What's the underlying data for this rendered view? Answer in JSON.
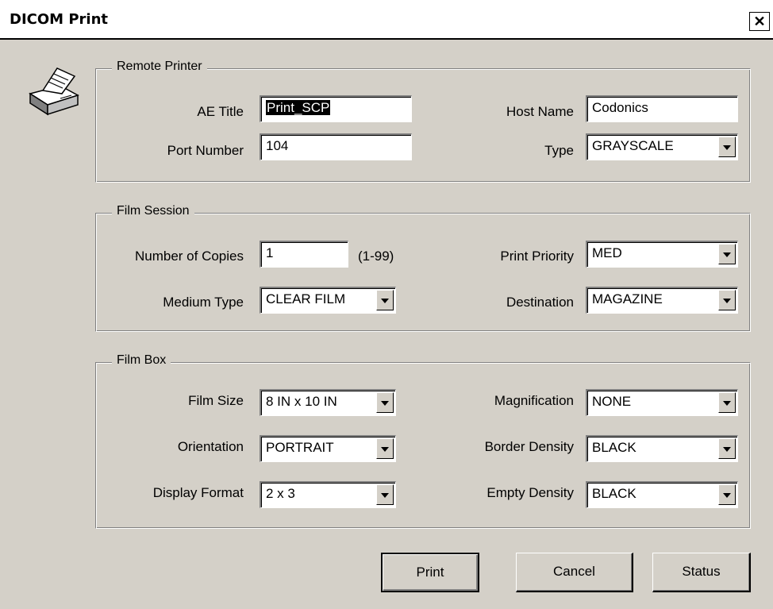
{
  "window": {
    "title": "DICOM Print",
    "close_label": "✕"
  },
  "remote_printer": {
    "legend": "Remote Printer",
    "ae_title_label": "AE Title",
    "ae_title_value": "Print_SCP",
    "host_name_label": "Host Name",
    "host_name_value": "Codonics",
    "port_number_label": "Port Number",
    "port_number_value": "104",
    "type_label": "Type",
    "type_value": "GRAYSCALE"
  },
  "film_session": {
    "legend": "Film Session",
    "copies_label": "Number of Copies",
    "copies_value": "1",
    "copies_hint": "(1-99)",
    "priority_label": "Print Priority",
    "priority_value": "MED",
    "medium_label": "Medium Type",
    "medium_value": "CLEAR FILM",
    "destination_label": "Destination",
    "destination_value": "MAGAZINE"
  },
  "film_box": {
    "legend": "Film Box",
    "film_size_label": "Film Size",
    "film_size_value": "8 IN x 10 IN",
    "magnification_label": "Magnification",
    "magnification_value": "NONE",
    "orientation_label": "Orientation",
    "orientation_value": "PORTRAIT",
    "border_density_label": "Border Density",
    "border_density_value": "BLACK",
    "display_format_label": "Display Format",
    "display_format_value": "2 x 3",
    "empty_density_label": "Empty Density",
    "empty_density_value": "BLACK"
  },
  "buttons": {
    "print": "Print",
    "cancel": "Cancel",
    "status": "Status"
  },
  "icons": {
    "printer": "printer-icon",
    "dropdown": "chevron-down-icon"
  }
}
